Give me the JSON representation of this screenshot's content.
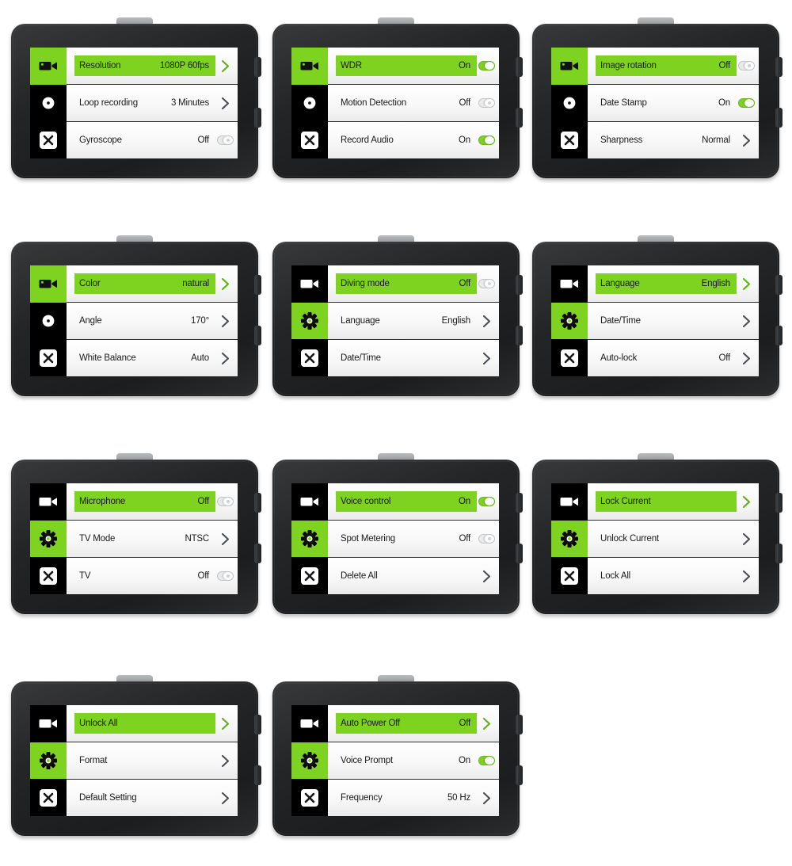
{
  "theme": {
    "accent_green": "#7ED321",
    "body_dark": "#232527",
    "screen_black": "#000000",
    "list_white": "#ffffff"
  },
  "icons": {
    "video_camera": "video-camera-icon",
    "gear": "gear-icon",
    "close_x": "close-x-icon",
    "chevron_right": "chevron-right-icon",
    "toggle": "toggle-switch"
  },
  "panels": [
    {
      "id": "panel-1",
      "active_rail_index": 0,
      "rows": [
        {
          "label": "Resolution",
          "value": "1080P 60fps",
          "control": "chevron",
          "highlighted": true
        },
        {
          "label": "Loop recording",
          "value": "3 Minutes",
          "control": "chevron",
          "highlighted": false
        },
        {
          "label": "Gyroscope",
          "value": "Off",
          "control": "toggle-off",
          "highlighted": false
        }
      ]
    },
    {
      "id": "panel-2",
      "active_rail_index": 0,
      "rows": [
        {
          "label": "WDR",
          "value": "On",
          "control": "toggle-on",
          "highlighted": true
        },
        {
          "label": "Motion Detection",
          "value": "Off",
          "control": "toggle-off",
          "highlighted": false
        },
        {
          "label": "Record Audio",
          "value": "On",
          "control": "toggle-on",
          "highlighted": false
        }
      ]
    },
    {
      "id": "panel-3",
      "active_rail_index": 0,
      "rows": [
        {
          "label": "Image rotation",
          "value": "Off",
          "control": "toggle-off",
          "highlighted": true
        },
        {
          "label": "Date Stamp",
          "value": "On",
          "control": "toggle-on",
          "highlighted": false
        },
        {
          "label": "Sharpness",
          "value": "Normal",
          "control": "chevron",
          "highlighted": false
        }
      ]
    },
    {
      "id": "panel-4",
      "active_rail_index": 0,
      "rows": [
        {
          "label": "Color",
          "value": "natural",
          "control": "chevron",
          "highlighted": true
        },
        {
          "label": "Angle",
          "value": "170°",
          "control": "chevron",
          "highlighted": false
        },
        {
          "label": "White Balance",
          "value": "Auto",
          "control": "chevron",
          "highlighted": false
        }
      ]
    },
    {
      "id": "panel-5",
      "active_rail_index": 1,
      "rows": [
        {
          "label": "Diving mode",
          "value": "Off",
          "control": "toggle-off",
          "highlighted": true
        },
        {
          "label": "Language",
          "value": "English",
          "control": "chevron",
          "highlighted": false
        },
        {
          "label": "Date/Time",
          "value": "",
          "control": "chevron",
          "highlighted": false
        }
      ]
    },
    {
      "id": "panel-6",
      "active_rail_index": 1,
      "rows": [
        {
          "label": "Language",
          "value": "English",
          "control": "chevron",
          "highlighted": true
        },
        {
          "label": "Date/Time",
          "value": "",
          "control": "chevron",
          "highlighted": false
        },
        {
          "label": "Auto-lock",
          "value": "Off",
          "control": "chevron",
          "highlighted": false
        }
      ]
    },
    {
      "id": "panel-7",
      "active_rail_index": 1,
      "rows": [
        {
          "label": "Microphone",
          "value": "Off",
          "control": "toggle-off",
          "highlighted": true
        },
        {
          "label": "TV Mode",
          "value": "NTSC",
          "control": "chevron",
          "highlighted": false
        },
        {
          "label": "TV",
          "value": "Off",
          "control": "toggle-off",
          "highlighted": false
        }
      ]
    },
    {
      "id": "panel-8",
      "active_rail_index": 1,
      "rows": [
        {
          "label": "Voice control",
          "value": "On",
          "control": "toggle-on",
          "highlighted": true
        },
        {
          "label": "Spot Metering",
          "value": "Off",
          "control": "toggle-off",
          "highlighted": false
        },
        {
          "label": "Delete All",
          "value": "",
          "control": "chevron",
          "highlighted": false
        }
      ]
    },
    {
      "id": "panel-9",
      "active_rail_index": 1,
      "rows": [
        {
          "label": "Lock Current",
          "value": "",
          "control": "chevron",
          "highlighted": true
        },
        {
          "label": "Unlock Current",
          "value": "",
          "control": "chevron",
          "highlighted": false
        },
        {
          "label": "Lock All",
          "value": "",
          "control": "chevron",
          "highlighted": false
        }
      ]
    },
    {
      "id": "panel-10",
      "active_rail_index": 1,
      "rows": [
        {
          "label": "Unlock All",
          "value": "",
          "control": "chevron",
          "highlighted": true
        },
        {
          "label": "Format",
          "value": "",
          "control": "chevron",
          "highlighted": false
        },
        {
          "label": "Default Setting",
          "value": "",
          "control": "chevron",
          "highlighted": false
        }
      ]
    },
    {
      "id": "panel-11",
      "active_rail_index": 1,
      "rows": [
        {
          "label": "Auto Power Off",
          "value": "Off",
          "control": "chevron",
          "highlighted": true
        },
        {
          "label": "Voice Prompt",
          "value": "On",
          "control": "toggle-on",
          "highlighted": false
        },
        {
          "label": "Frequency",
          "value": "50 Hz",
          "control": "chevron",
          "highlighted": false
        }
      ]
    }
  ]
}
